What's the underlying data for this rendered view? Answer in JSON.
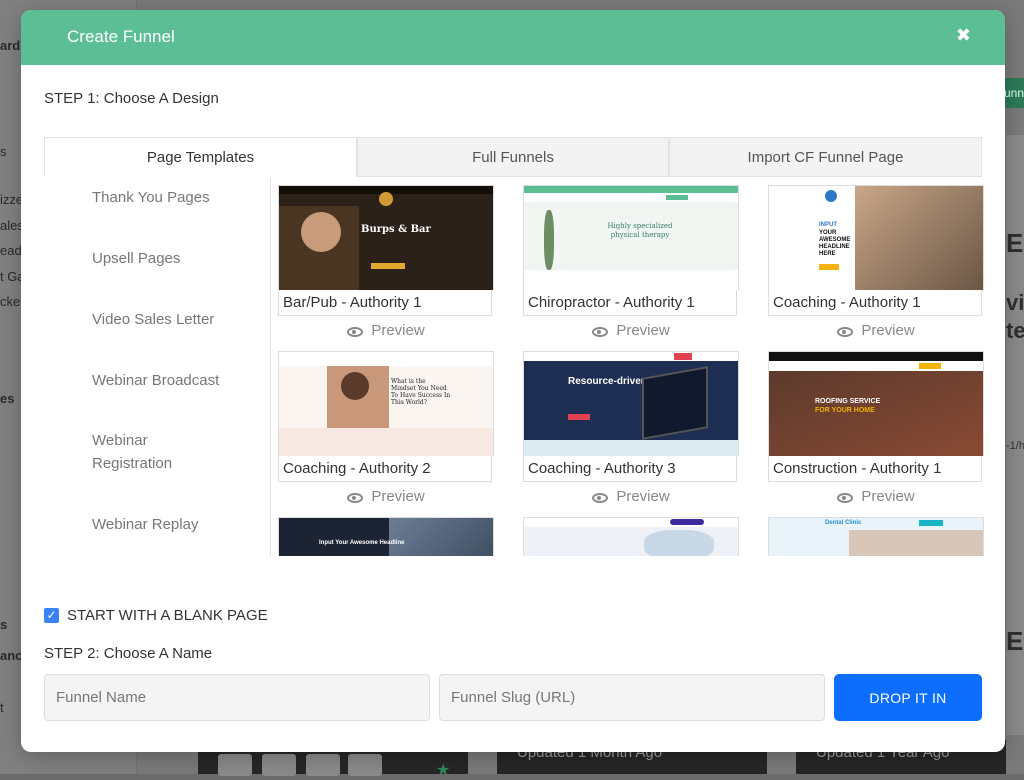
{
  "background": {
    "sidebar_fragments": [
      "ard",
      "s",
      "izze",
      "ales",
      "ead",
      "t Ga",
      "cker",
      "es",
      "s",
      "ance",
      "t"
    ],
    "cards": [
      "Updated 1 Month Ago",
      "Updated 1 Year Ago"
    ],
    "green_button_fragment": "unn",
    "right_panel_fragments": [
      "E",
      "vi",
      "te",
      "E"
    ],
    "right_panel_small": "-1/h"
  },
  "modal": {
    "title": "Create Funnel",
    "close_icon": "close-icon",
    "step1": "STEP 1: Choose A Design",
    "tabs": [
      {
        "label": "Page Templates",
        "active": true
      },
      {
        "label": "Full Funnels",
        "active": false
      },
      {
        "label": "Import CF Funnel Page",
        "active": false
      }
    ],
    "categories": [
      "Thank You Pages",
      "Upsell Pages",
      "Video Sales Letter",
      "Webinar Broadcast",
      "Webinar Registration",
      "Webinar Replay"
    ],
    "preview_label": "Preview",
    "templates": [
      {
        "name": "Bar/Pub - Authority 1",
        "thumb": {
          "headline": "Burps & Bar",
          "bg": "#2b2118"
        }
      },
      {
        "name": "Chiropractor - Authority 1",
        "thumb": {
          "headline": "Highly specialized physical therapy",
          "bg": "#f1f6f3"
        }
      },
      {
        "name": "Coaching - Authority 1",
        "thumb": {
          "headline": "YOUR AWESOME HEADLINE HERE",
          "kicker": "INPUT",
          "bg": "#ffffff"
        }
      },
      {
        "name": "Coaching - Authority 2",
        "thumb": {
          "headline": "What is the Mindset You Need To Have Success In This World?",
          "bg": "#fbf5f1"
        }
      },
      {
        "name": "Coaching - Authority 3",
        "thumb": {
          "headline": "Resource-driven.",
          "bg": "#1e2e52"
        }
      },
      {
        "name": "Construction - Authority 1",
        "thumb": {
          "headline": "ROOFING SERVICE",
          "sub": "FOR YOUR HOME",
          "bg": "#3a2a22"
        }
      },
      {
        "name": "",
        "thumb": {
          "headline": "Input Your Awesome Headline",
          "bg": "#1c2433"
        }
      },
      {
        "name": "",
        "thumb": {
          "headline": "",
          "bg": "#eef2f6"
        }
      },
      {
        "name": "",
        "thumb": {
          "headline": "Dental Clinic",
          "bg": "#e9f3fa"
        }
      }
    ],
    "blank_page": {
      "label": "START WITH A BLANK PAGE",
      "checked": true
    },
    "step2": "STEP 2: Choose A Name",
    "inputs": {
      "name_placeholder": "Funnel Name",
      "slug_placeholder": "Funnel Slug (URL)"
    },
    "submit_label": "DROP IT IN",
    "colors": {
      "header": "#5cbe95",
      "button": "#0d6efd",
      "checkbox": "#3b82f6"
    }
  }
}
